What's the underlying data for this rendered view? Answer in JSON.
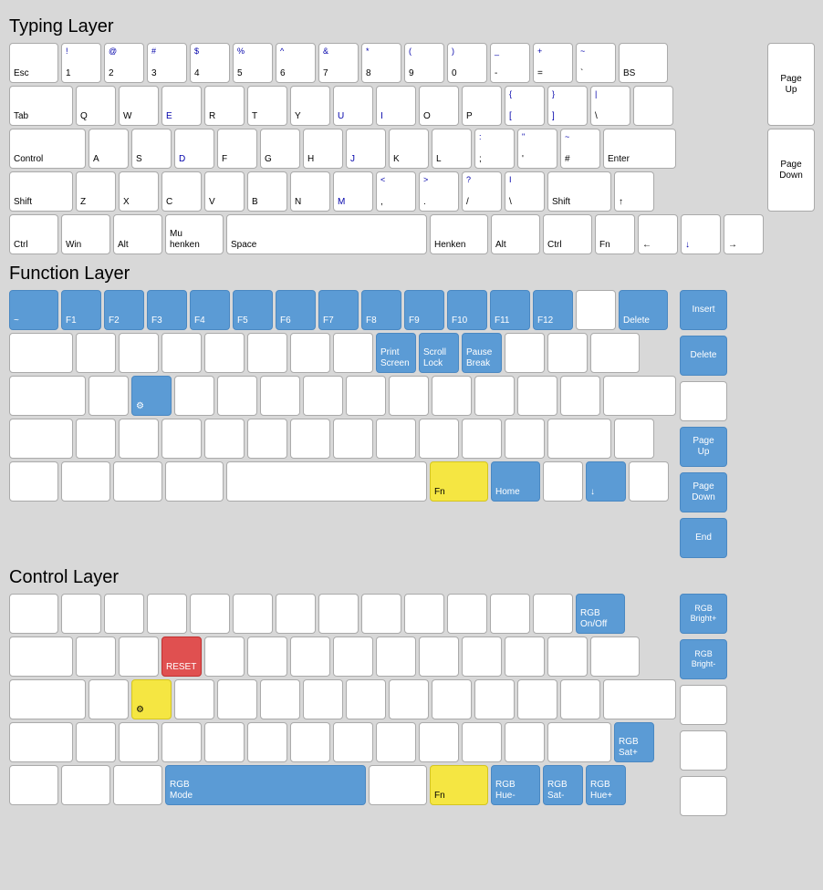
{
  "sections": [
    {
      "title": "Typing Layer",
      "id": "typing"
    },
    {
      "title": "Function Layer",
      "id": "function"
    },
    {
      "title": "Control Layer",
      "id": "control"
    }
  ]
}
